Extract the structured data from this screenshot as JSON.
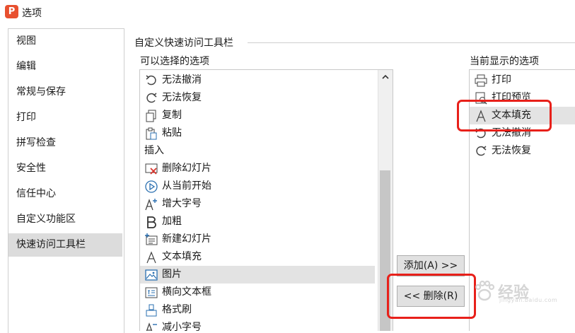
{
  "window": {
    "title": "选项",
    "logo_letter": "P",
    "logo_color": "#e8502f"
  },
  "sidebar": {
    "items": [
      {
        "label": "视图"
      },
      {
        "label": "编辑"
      },
      {
        "label": "常规与保存"
      },
      {
        "label": "打印"
      },
      {
        "label": "拼写检查"
      },
      {
        "label": "安全性"
      },
      {
        "label": "信任中心"
      },
      {
        "label": "自定义功能区"
      },
      {
        "label": "快速访问工具栏",
        "selected": true
      }
    ]
  },
  "panel": {
    "group_title": "自定义快速访问工具栏",
    "available_label": "可以选择的选项",
    "current_label": "当前显示的选项"
  },
  "available": {
    "items": [
      {
        "label": "无法撤消",
        "icon": "undo-icon"
      },
      {
        "label": "无法恢复",
        "icon": "redo-icon"
      },
      {
        "label": "复制",
        "icon": "copy-icon"
      },
      {
        "label": "粘贴",
        "icon": "paste-icon"
      },
      {
        "label": "插入",
        "category": true
      },
      {
        "label": "删除幻灯片",
        "icon": "delete-slide-icon"
      },
      {
        "label": "从当前开始",
        "icon": "play-icon"
      },
      {
        "label": "增大字号",
        "icon": "font-increase-icon"
      },
      {
        "label": "加粗",
        "icon": "bold-icon"
      },
      {
        "label": "新建幻灯片",
        "icon": "new-slide-icon"
      },
      {
        "label": "文本填充",
        "icon": "text-fill-icon"
      },
      {
        "label": "图片",
        "icon": "picture-icon",
        "selected": true
      },
      {
        "label": "横向文本框",
        "icon": "textbox-icon"
      },
      {
        "label": "格式刷",
        "icon": "format-painter-icon"
      },
      {
        "label": "减小字号",
        "icon": "font-decrease-icon"
      }
    ]
  },
  "buttons": {
    "add_label": "添加(A) >>",
    "remove_label": "<< 删除(R)"
  },
  "current": {
    "items": [
      {
        "label": "打印",
        "icon": "print-icon"
      },
      {
        "label": "打印预览",
        "icon": "print-preview-icon"
      },
      {
        "label": "文本填充",
        "icon": "text-fill-icon",
        "selected": true
      },
      {
        "label": "无法撤消",
        "icon": "undo-icon"
      },
      {
        "label": "无法恢复",
        "icon": "redo-icon"
      }
    ]
  },
  "highlight_color": "#e8201a",
  "watermark": {
    "text": "经验",
    "subtext": "jingyan.baidu.com"
  }
}
